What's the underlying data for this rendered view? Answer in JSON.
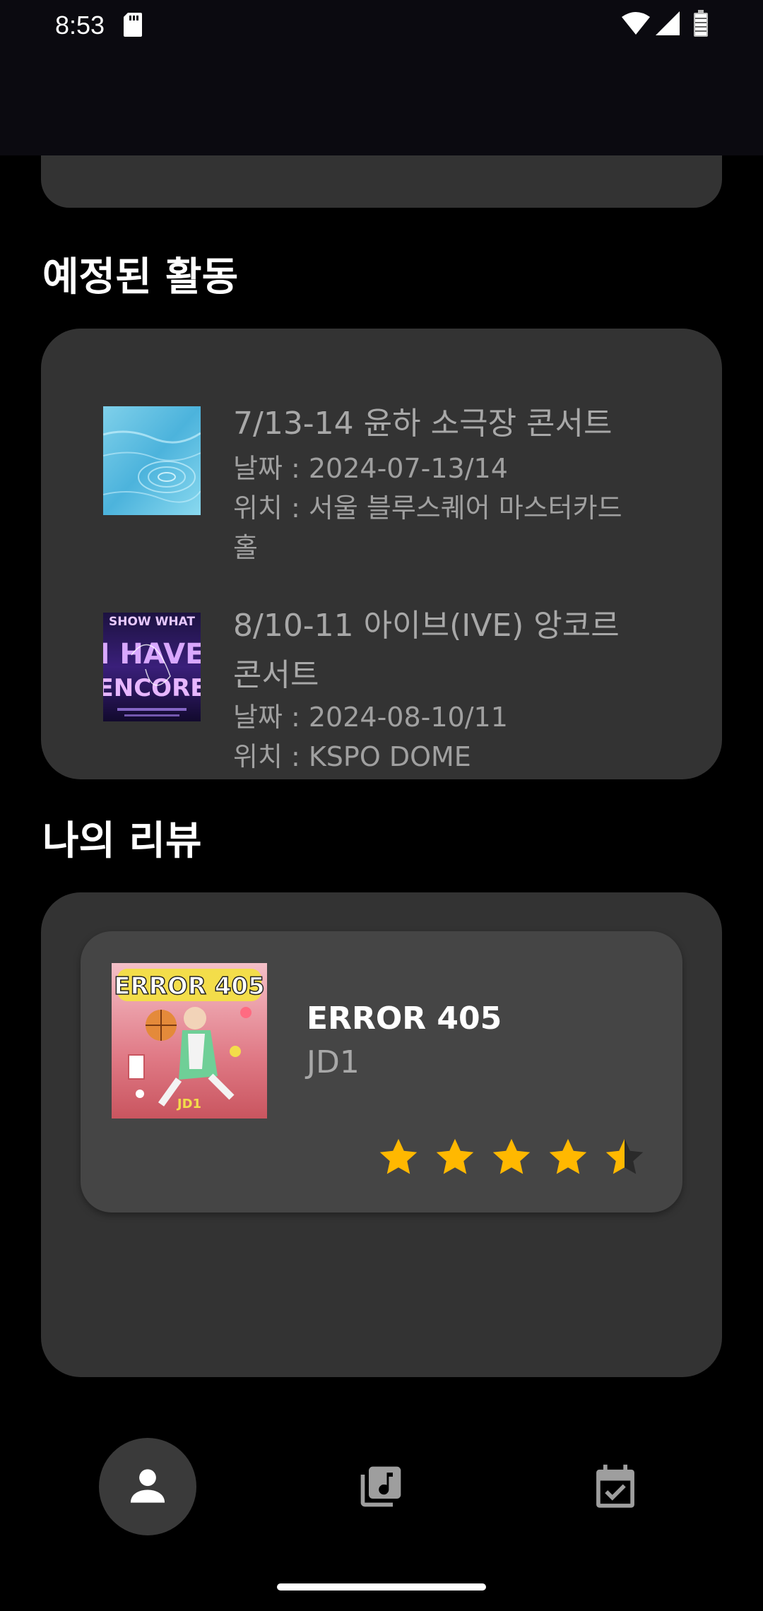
{
  "status_bar": {
    "time": "8:53"
  },
  "sections": {
    "upcoming_title": "예정된 활동",
    "reviews_title": "나의 리뷰"
  },
  "events": [
    {
      "title": "7/13-14 윤하 소극장 콘서트",
      "date": "날짜 : 2024-07-13/14",
      "location": "위치 : 서울 블루스퀘어 마스터카드",
      "location_cont": "홀"
    },
    {
      "title": "8/10-11 아이브(IVE) 앙코르",
      "title_cont": "콘서트",
      "date": "날짜 : 2024-08-10/11",
      "location": "위치 : KSPO DOME",
      "poster_text_1": "SHOW WHAT",
      "poster_text_2": "I HAVE",
      "poster_text_3": "ENCORE"
    }
  ],
  "review": {
    "title": "ERROR 405",
    "artist": "JD1",
    "rating": 4.5,
    "rating_max": 5,
    "cover_text": "ERROR 405"
  },
  "nav": {
    "items": [
      "profile-icon",
      "music-library-icon",
      "calendar-check-icon"
    ],
    "active": "profile"
  },
  "colors": {
    "background": "#000000",
    "card": "#333333",
    "review_card": "#454545",
    "star": "#FFB800",
    "star_empty": "#2a2a2a",
    "muted_text": "#a8a8a8"
  }
}
